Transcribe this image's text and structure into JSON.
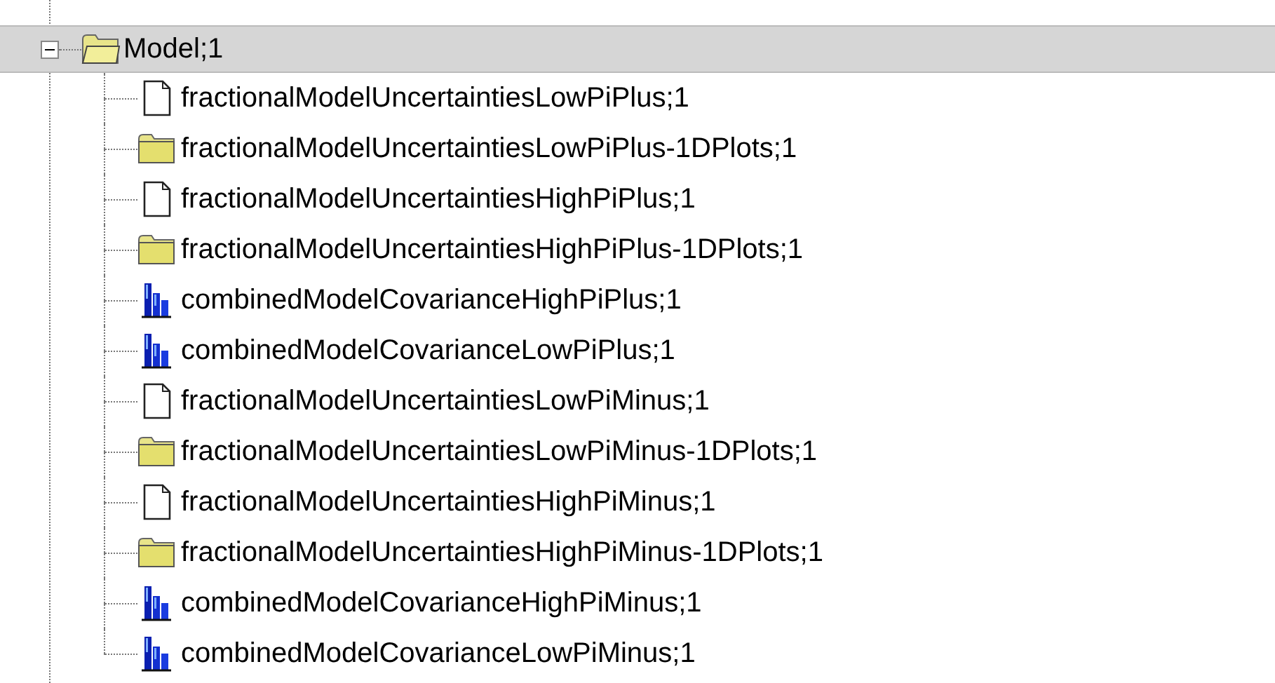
{
  "tree": {
    "label": "Model;1",
    "expanded": true,
    "selected": true,
    "children": [
      {
        "label": "fractionalModelUncertaintiesLowPiPlus;1",
        "kind": "file",
        "selected": false
      },
      {
        "label": "fractionalModelUncertaintiesLowPiPlus-1DPlots;1",
        "kind": "folder",
        "selected": false
      },
      {
        "label": "fractionalModelUncertaintiesHighPiPlus;1",
        "kind": "file",
        "selected": false
      },
      {
        "label": "fractionalModelUncertaintiesHighPiPlus-1DPlots;1",
        "kind": "folder",
        "selected": false
      },
      {
        "label": "combinedModelCovarianceHighPiPlus;1",
        "kind": "histogram",
        "selected": false
      },
      {
        "label": "combinedModelCovarianceLowPiPlus;1",
        "kind": "histogram",
        "selected": false
      },
      {
        "label": "fractionalModelUncertaintiesLowPiMinus;1",
        "kind": "file",
        "selected": false
      },
      {
        "label": "fractionalModelUncertaintiesLowPiMinus-1DPlots;1",
        "kind": "folder",
        "selected": false
      },
      {
        "label": "fractionalModelUncertaintiesHighPiMinus;1",
        "kind": "file",
        "selected": false
      },
      {
        "label": "fractionalModelUncertaintiesHighPiMinus-1DPlots;1",
        "kind": "folder",
        "selected": false
      },
      {
        "label": "combinedModelCovarianceHighPiMinus;1",
        "kind": "histogram",
        "selected": false
      },
      {
        "label": "combinedModelCovarianceLowPiMinus;1",
        "kind": "histogram",
        "selected": false
      }
    ]
  }
}
